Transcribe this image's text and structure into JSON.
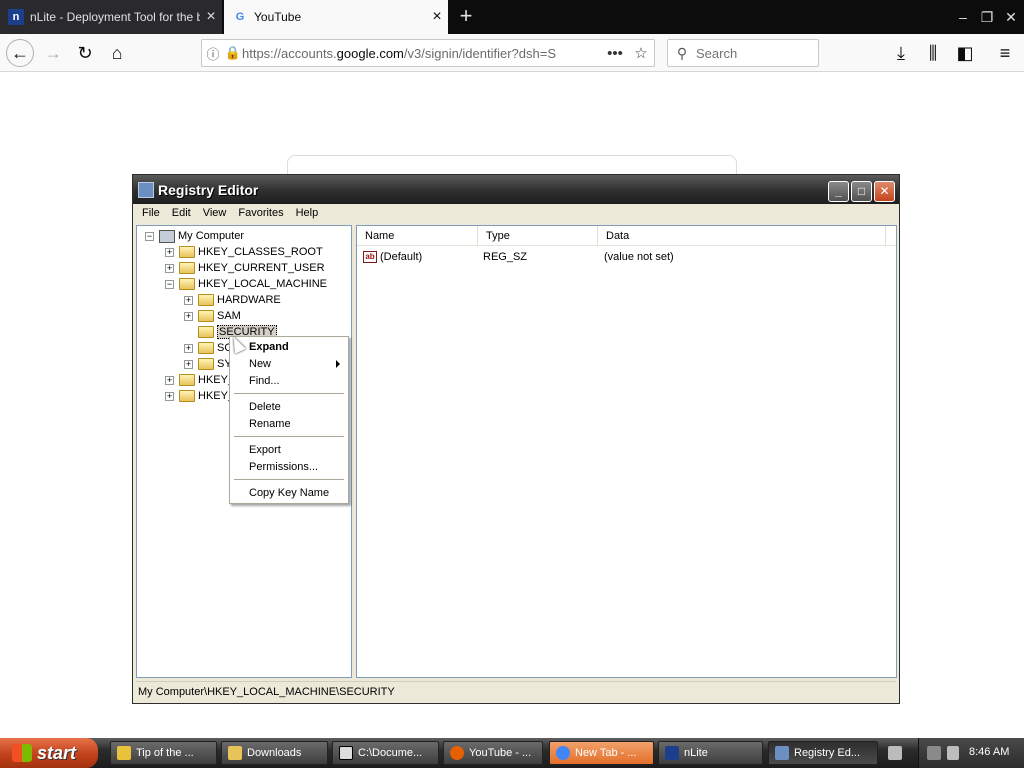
{
  "browser": {
    "tabs": [
      {
        "title": "nLite - Deployment Tool for the bo",
        "favicon": "nlite-icon"
      },
      {
        "title": "YouTube",
        "favicon": "google-g-icon"
      }
    ],
    "url_prefix": "https://accounts.",
    "url_domain": "google.com",
    "url_rest": "/v3/signin/identifier?dsh=S",
    "search_placeholder": "Search"
  },
  "regedit": {
    "title": "Registry Editor",
    "menu": [
      "File",
      "Edit",
      "View",
      "Favorites",
      "Help"
    ],
    "tree": {
      "root": "My Computer",
      "hives": {
        "classes_root": "HKEY_CLASSES_ROOT",
        "current_user": "HKEY_CURRENT_USER",
        "local_machine": "HKEY_LOCAL_MACHINE",
        "hardware": "HARDWARE",
        "sam": "SAM",
        "security": "SECURITY",
        "software_partial": "SO",
        "system_partial": "SY",
        "users_partial": "HKEY_",
        "current_config_partial": "HKEY_"
      }
    },
    "columns": {
      "name": "Name",
      "type": "Type",
      "data": "Data"
    },
    "rows": [
      {
        "name": "(Default)",
        "type": "REG_SZ",
        "data": "(value not set)"
      }
    ],
    "status": "My Computer\\HKEY_LOCAL_MACHINE\\SECURITY"
  },
  "context_menu": {
    "expand": "Expand",
    "new": "New",
    "find": "Find...",
    "delete": "Delete",
    "rename": "Rename",
    "export": "Export",
    "permissions": "Permissions...",
    "copy_key_name": "Copy Key Name"
  },
  "taskbar": {
    "start": "start",
    "tasks": [
      {
        "label": "Tip of the ...",
        "icon": "lightbulb-icon"
      },
      {
        "label": "Downloads",
        "icon": "folder-icon"
      },
      {
        "label": "C:\\Docume...",
        "icon": "7zip-icon"
      },
      {
        "label": "YouTube - ...",
        "icon": "firefox-icon"
      },
      {
        "label": "New Tab - ...",
        "icon": "chrome-icon"
      },
      {
        "label": "nLite",
        "icon": "nlite-icon"
      },
      {
        "label": "Registry Ed...",
        "icon": "regedit-icon"
      }
    ],
    "clock": "8:46 AM"
  },
  "colors": {
    "start_button": "#c0411b",
    "highlight_task": "#e36f2a",
    "selection": "#d4d0c8"
  }
}
